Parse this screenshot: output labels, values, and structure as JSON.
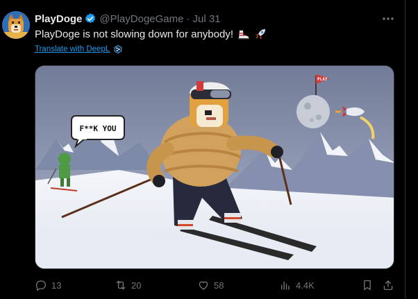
{
  "post": {
    "author_name": "PlayDoge",
    "handle": "@PlayDogeGame",
    "separator": "·",
    "date": "Jul 31",
    "text": "PlayDoge is not slowing down for anybody!",
    "emojis": [
      "ski-boot",
      "rocket"
    ],
    "translate_label": "Translate with DeepL"
  },
  "media": {
    "speech_bubble_text": "F**K YOU",
    "flag_text": "PLAY"
  },
  "actions": {
    "replies": "13",
    "reposts": "20",
    "likes": "58",
    "views": "4.4K"
  },
  "colors": {
    "background": "#000000",
    "text_primary": "#e7e9ea",
    "text_secondary": "#71767b",
    "link": "#1d9bf0",
    "verified": "#1d9bf0"
  },
  "icons": {
    "more": "more-horizontal-icon",
    "reply": "reply-icon",
    "repost": "repost-icon",
    "like": "like-icon",
    "views": "views-icon",
    "bookmark": "bookmark-icon",
    "share": "share-icon"
  }
}
